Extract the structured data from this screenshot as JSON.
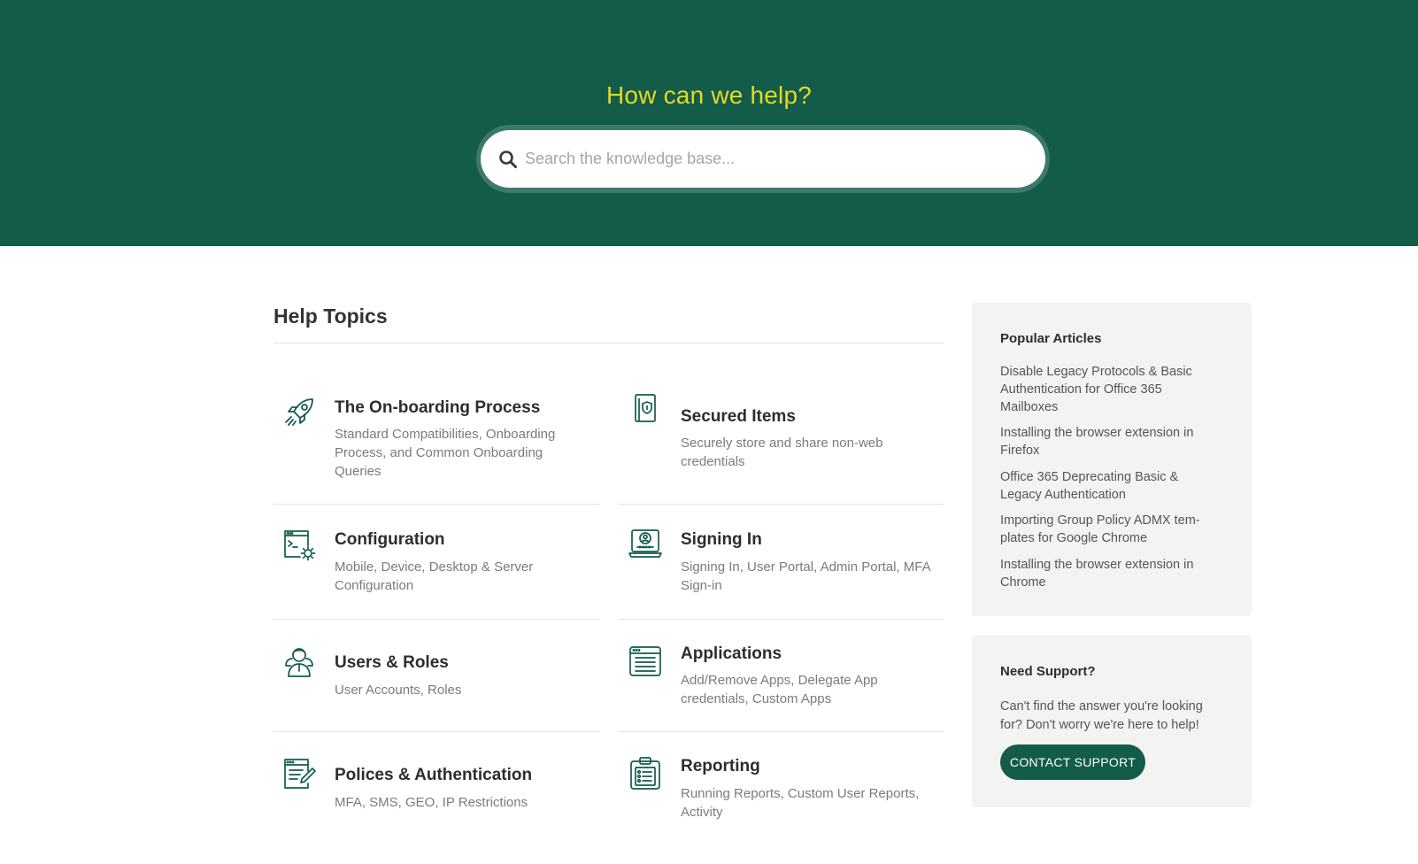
{
  "hero": {
    "title": "How can we help?",
    "search_placeholder": "Search the knowledge base...",
    "bg_color": "#135c4a",
    "title_color": "#e6d823"
  },
  "topics": {
    "heading": "Help Topics",
    "items": [
      {
        "icon": "rocket-icon",
        "title": "The On-boarding Process",
        "desc": "Standard Compatibilities, Onboarding Process, and Common Onboarding Queries"
      },
      {
        "icon": "secured-items-icon",
        "title": "Secured Items",
        "desc": "Securely store and share non-web credentials"
      },
      {
        "icon": "configuration-icon",
        "title": "Configuration",
        "desc": "Mobile, Device, Desktop & Server Configuration"
      },
      {
        "icon": "signing-in-icon",
        "title": "Signing In",
        "desc": "Signing In, User Portal, Admin Portal, MFA Sign-in"
      },
      {
        "icon": "users-roles-icon",
        "title": "Users & Roles",
        "desc": "User Accounts, Roles"
      },
      {
        "icon": "applications-icon",
        "title": "Applications",
        "desc": "Add/Remove Apps, Delegate App credentials, Custom Apps"
      },
      {
        "icon": "policies-icon",
        "title": "Polices & Authentication",
        "desc": "MFA, SMS, GEO, IP Restrictions"
      },
      {
        "icon": "reporting-icon",
        "title": "Reporting",
        "desc": "Running Reports, Custom User Reports, Activity"
      }
    ]
  },
  "popular": {
    "title": "Popular Articles",
    "articles": [
      "Disable Legacy Protocols & Basic Authentication for Office 365 Mailboxes",
      "Installing the browser extension in Firefox",
      "Office 365 Deprecating Basic & Legacy Authentication",
      "Importing Group Policy ADMX tem-plates for Google Chrome",
      "Installing the browser extension in Chrome"
    ]
  },
  "support": {
    "title": "Need Support?",
    "text": "Can't find the answer you're looking for? Don't worry we're here to help!",
    "button_label": "CONTACT SUPPORT"
  }
}
